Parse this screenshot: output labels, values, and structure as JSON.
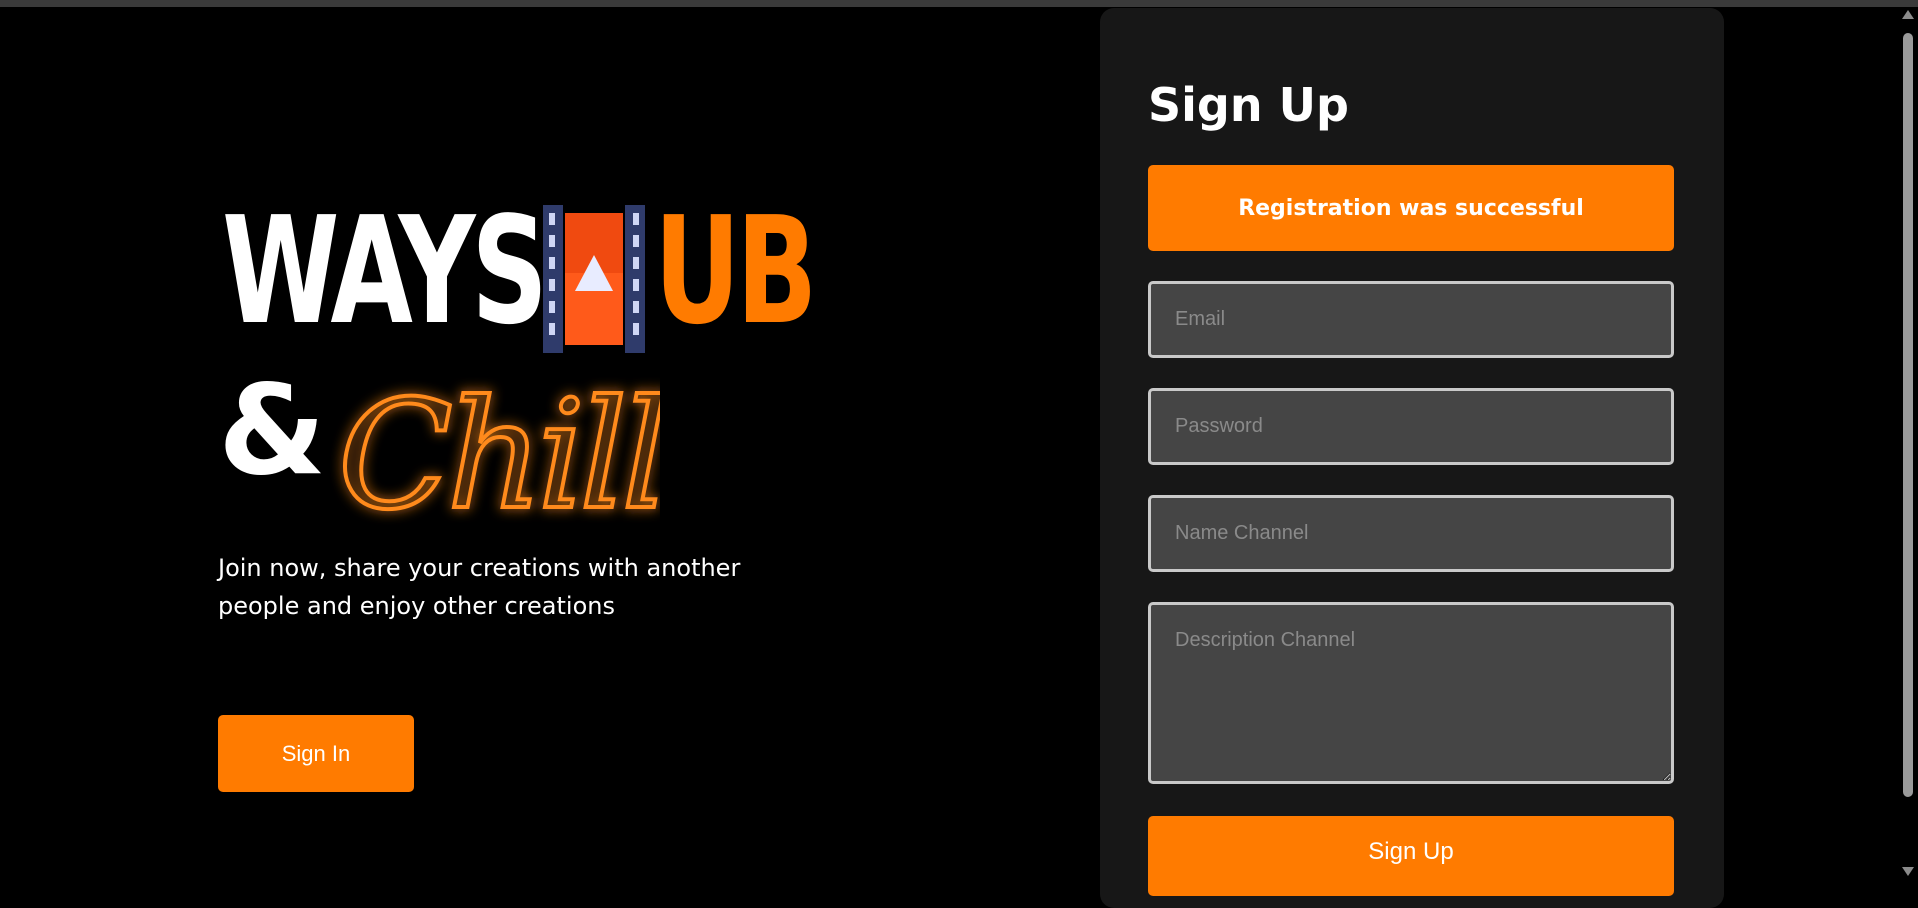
{
  "brand": {
    "line1_left": "WAYS",
    "line1_right": "UB",
    "line2_amp": "&",
    "line2_script": "Chill",
    "film_icon": "film-play-icon",
    "accent_color": "#ff7b00"
  },
  "hero": {
    "tagline": "Join now, share your creations with another people and enjoy other creations",
    "signin_label": "Sign In"
  },
  "signup": {
    "title": "Sign Up",
    "alert": "Registration was successful",
    "email_placeholder": "Email",
    "password_placeholder": "Password",
    "name_channel_placeholder": "Name Channel",
    "description_channel_placeholder": "Description Channel",
    "submit_label": "Sign Up"
  }
}
